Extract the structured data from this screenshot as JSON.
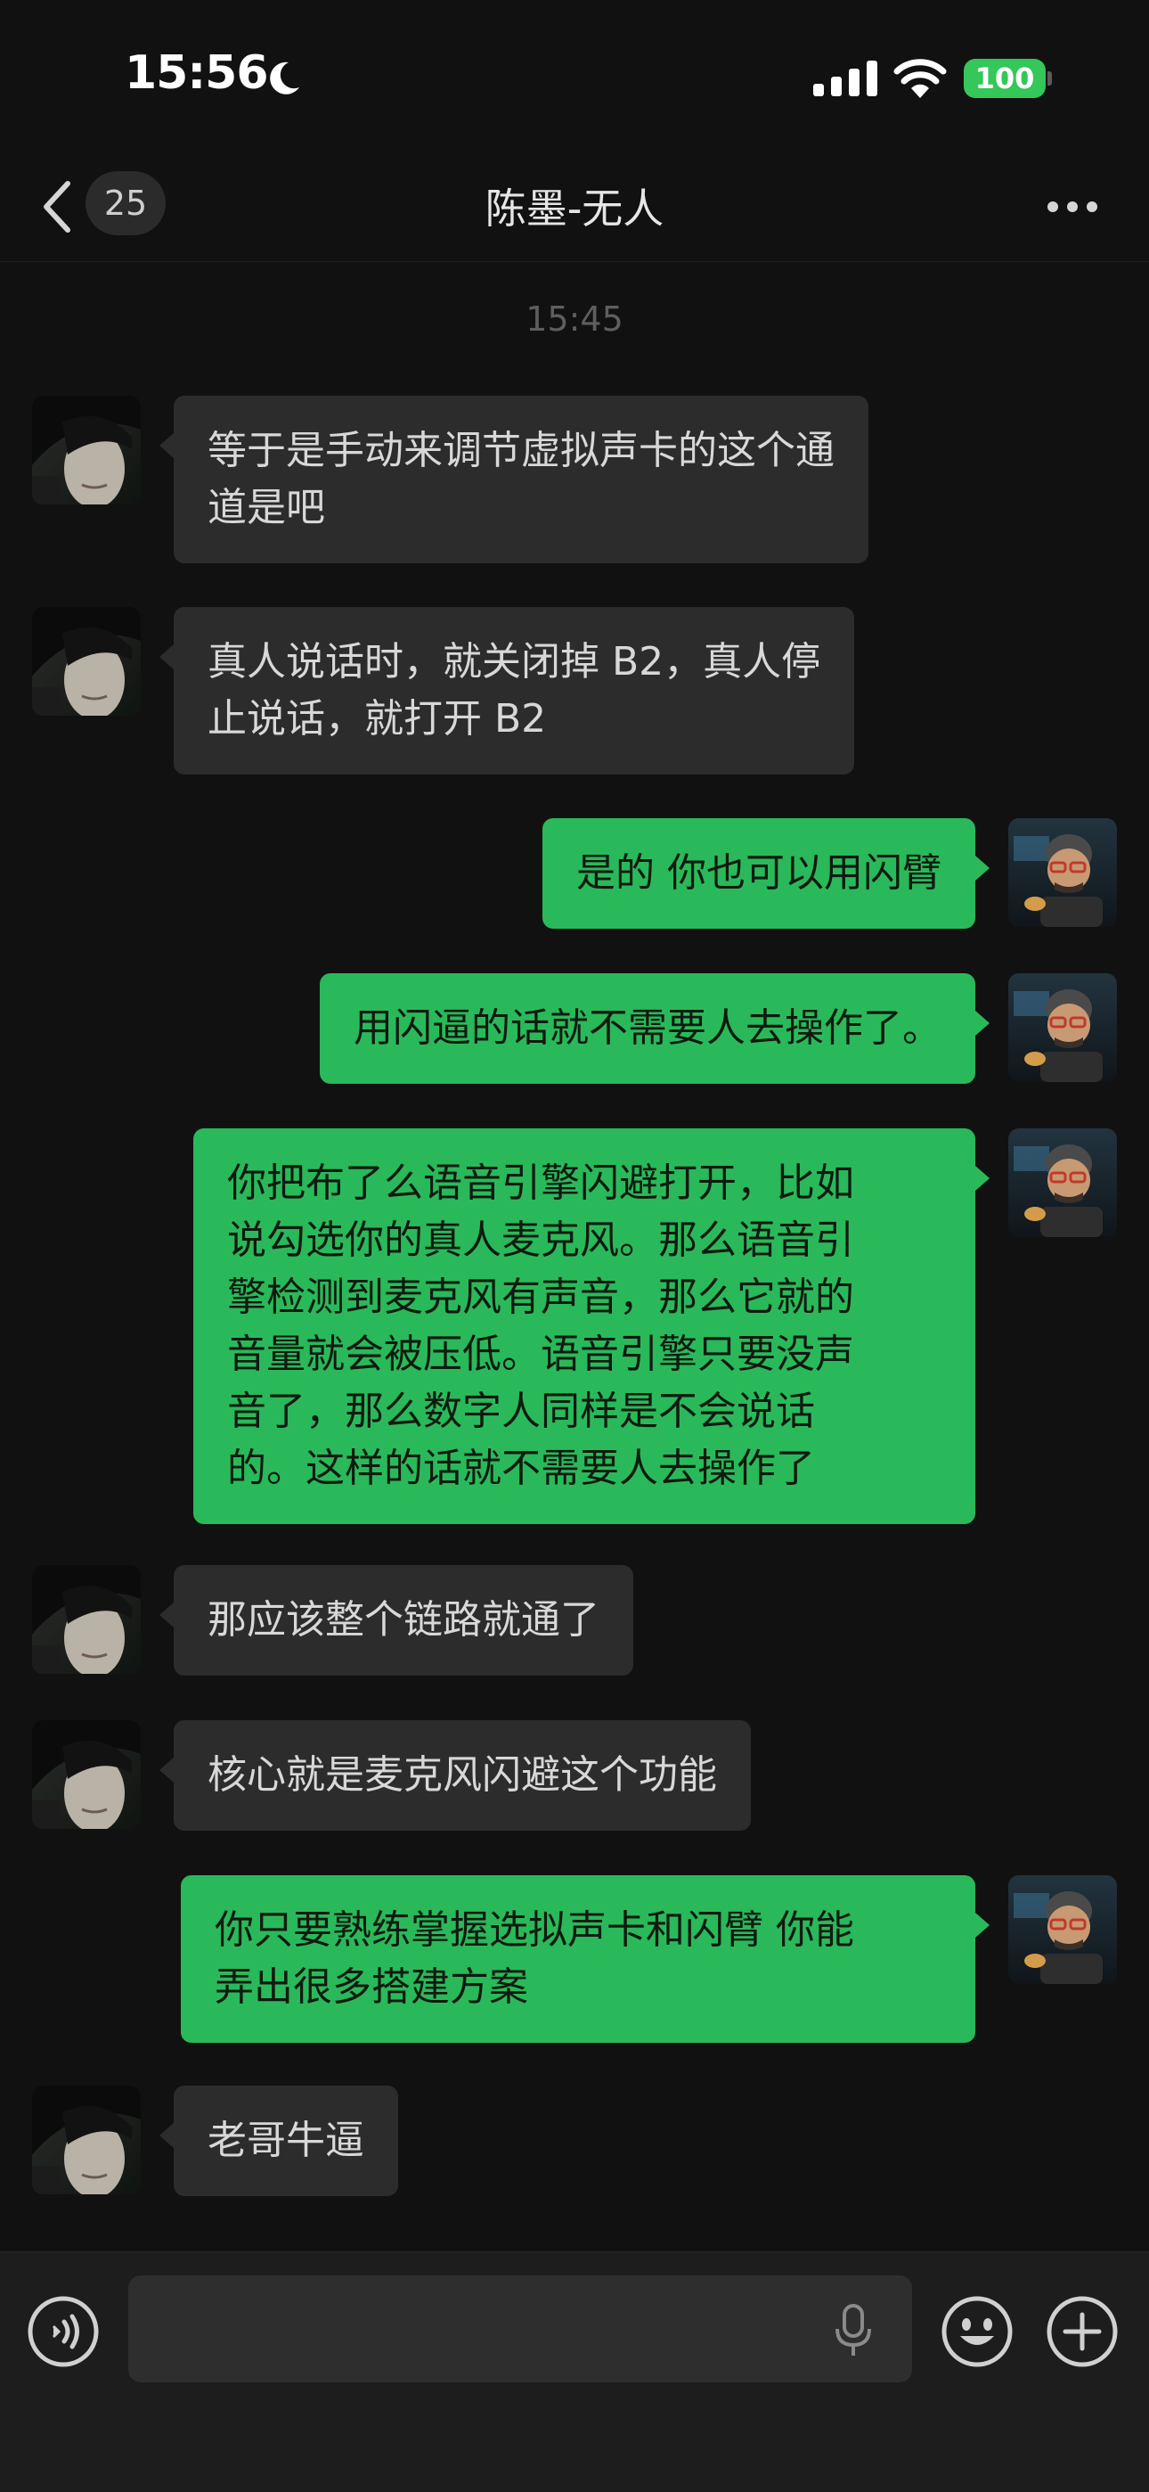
{
  "status_bar": {
    "time": "15:56",
    "battery": "100"
  },
  "nav": {
    "back_count": "25",
    "title": "陈墨-无人"
  },
  "timestamp": "15:45",
  "messages": [
    {
      "side": "in",
      "text": "等于是手动来调节虚拟声卡的这个通\n道是吧"
    },
    {
      "side": "in",
      "text": "真人说话时，就关闭掉 B2，真人停\n止说话，就打开 B2"
    },
    {
      "side": "out",
      "text": "是的 你也可以用闪臂"
    },
    {
      "side": "out",
      "text": "用闪逼的话就不需要人去操作了。"
    },
    {
      "side": "out",
      "text": "你把布了么语音引擎闪避打开，比如\n说勾选你的真人麦克风。那么语音引\n擎检测到麦克风有声音，那么它就的\n音量就会被压低。语音引擎只要没声\n音了，那么数字人同样是不会说话\n的。这样的话就不需要人去操作了"
    },
    {
      "side": "in",
      "text": "那应该整个链路就通了"
    },
    {
      "side": "in",
      "text": "核心就是麦克风闪避这个功能"
    },
    {
      "side": "out",
      "text": "你只要熟练掌握选拟声卡和闪臂 你能\n弄出很多搭建方案"
    },
    {
      "side": "in",
      "text": "老哥牛逼"
    }
  ],
  "input": {
    "value": "",
    "placeholder": ""
  },
  "icons": {
    "back": "chevron-left-icon",
    "more": "more-dots-icon",
    "voice": "voice-mode-icon",
    "mic": "microphone-icon",
    "emoji": "emoji-icon",
    "plus": "plus-icon"
  },
  "colors": {
    "outgoing_bubble": "#2ab95a",
    "incoming_bubble": "#2c2c2c",
    "background": "#111111",
    "battery": "#34c759"
  }
}
